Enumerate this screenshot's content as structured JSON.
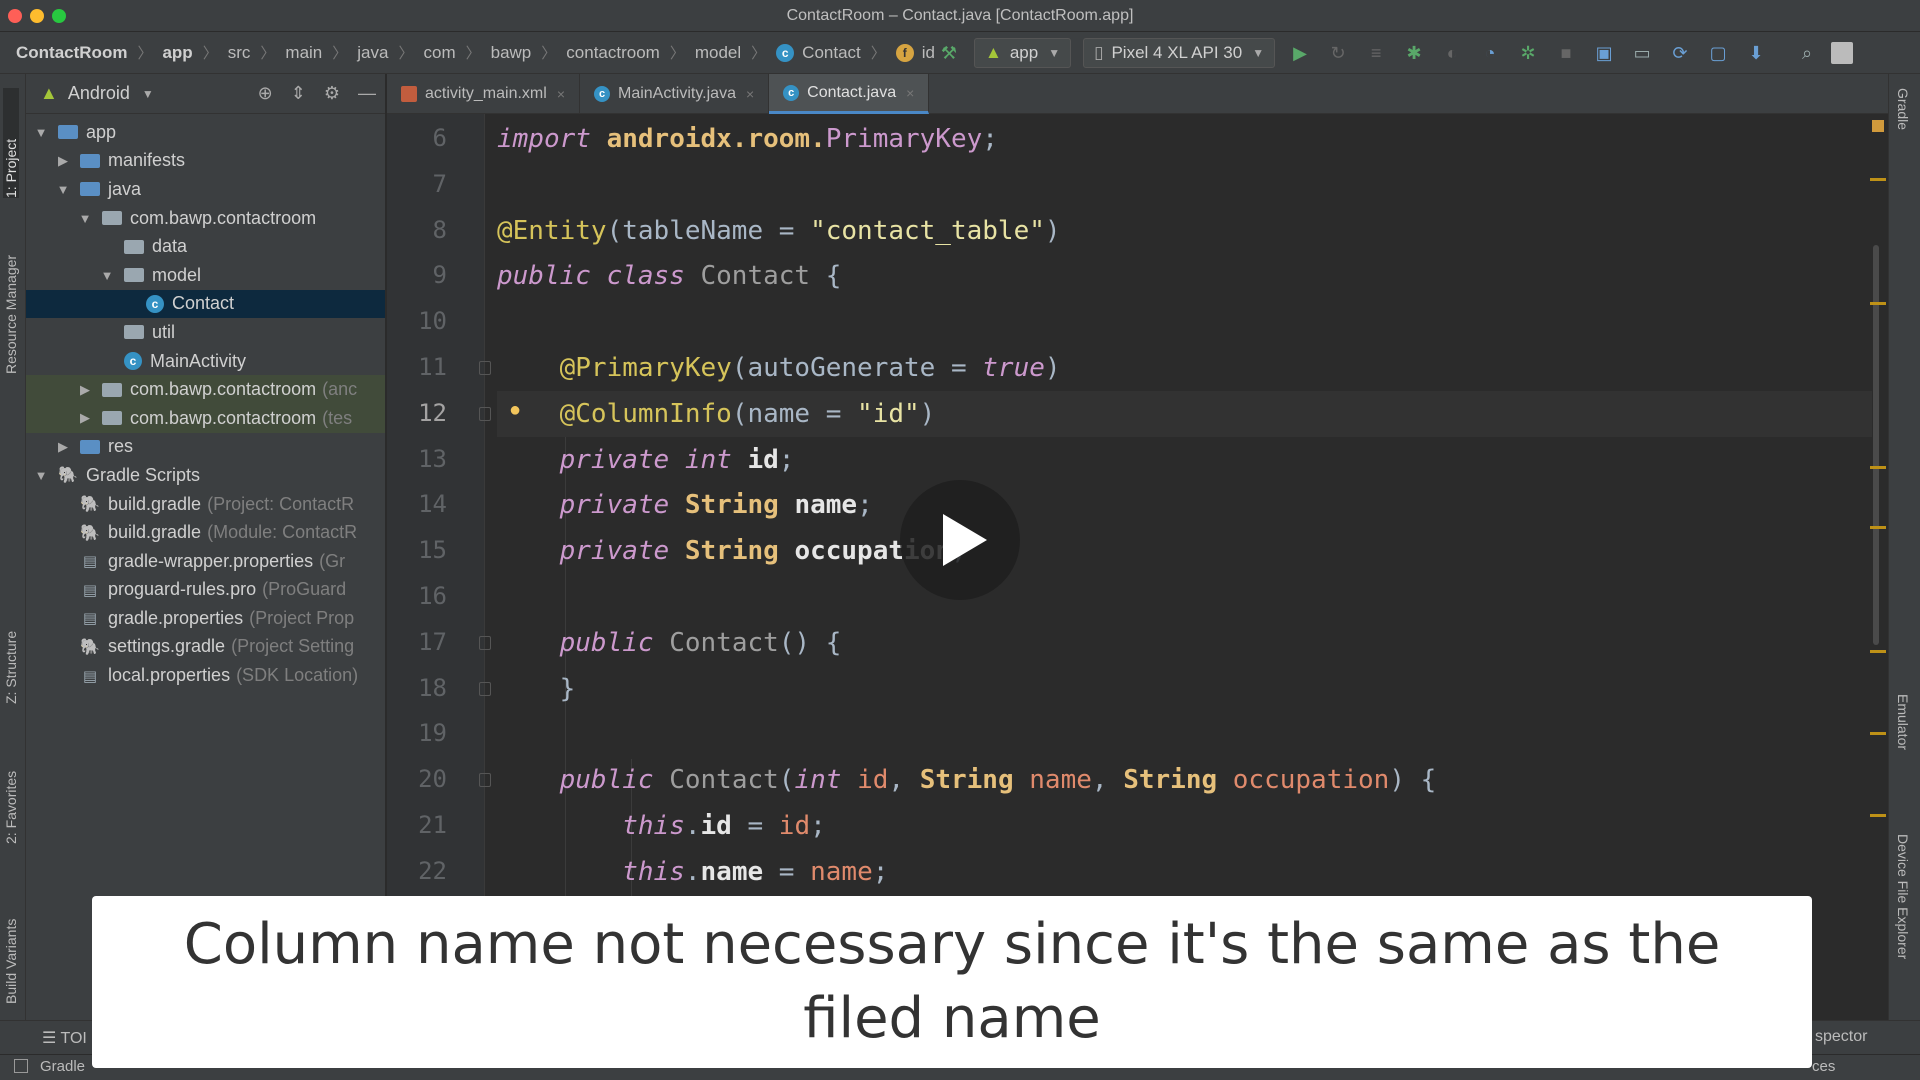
{
  "window": {
    "title": "ContactRoom – Contact.java [ContactRoom.app]"
  },
  "breadcrumb": [
    "ContactRoom",
    "app",
    "src",
    "main",
    "java",
    "com",
    "bawp",
    "contactroom",
    "model",
    "Contact",
    "id"
  ],
  "toolbar": {
    "run_config": "app",
    "device": "Pixel 4 XL API 30"
  },
  "left_tabs": {
    "project": "1: Project",
    "resource_manager": "Resource Manager",
    "structure": "Z: Structure",
    "favorites": "2: Favorites",
    "build_variants": "Build Variants"
  },
  "right_tabs": {
    "gradle": "Gradle",
    "emulator": "Emulator",
    "device_file_explorer": "Device File Explorer"
  },
  "project_panel": {
    "view": "Android",
    "tree": [
      {
        "label": "app",
        "suffix": "",
        "level": 0,
        "arrow": "down",
        "icon": "app"
      },
      {
        "label": "manifests",
        "suffix": "",
        "level": 1,
        "arrow": "right",
        "icon": "folder"
      },
      {
        "label": "java",
        "suffix": "",
        "level": 1,
        "arrow": "down",
        "icon": "folder"
      },
      {
        "label": "com.bawp.contactroom",
        "suffix": "",
        "level": 2,
        "arrow": "down",
        "icon": "pkg"
      },
      {
        "label": "data",
        "suffix": "",
        "level": 3,
        "arrow": "",
        "icon": "pkg"
      },
      {
        "label": "model",
        "suffix": "",
        "level": 3,
        "arrow": "down",
        "icon": "pkg"
      },
      {
        "label": "Contact",
        "suffix": "",
        "level": 4,
        "arrow": "",
        "icon": "class",
        "selected": true
      },
      {
        "label": "util",
        "suffix": "",
        "level": 3,
        "arrow": "",
        "icon": "pkg"
      },
      {
        "label": "MainActivity",
        "suffix": "",
        "level": 3,
        "arrow": "",
        "icon": "class"
      },
      {
        "label": "com.bawp.contactroom",
        "suffix": "(anc",
        "level": 2,
        "arrow": "right",
        "icon": "pkg",
        "hilite": true
      },
      {
        "label": "com.bawp.contactroom",
        "suffix": "(tes",
        "level": 2,
        "arrow": "right",
        "icon": "pkg",
        "hilite": true
      },
      {
        "label": "res",
        "suffix": "",
        "level": 1,
        "arrow": "right",
        "icon": "folder"
      },
      {
        "label": "Gradle Scripts",
        "suffix": "",
        "level": 0,
        "arrow": "down",
        "icon": "gradle"
      },
      {
        "label": "build.gradle",
        "suffix": "(Project: ContactR",
        "level": 1,
        "arrow": "",
        "icon": "gradle"
      },
      {
        "label": "build.gradle",
        "suffix": "(Module: ContactR",
        "level": 1,
        "arrow": "",
        "icon": "gradle"
      },
      {
        "label": "gradle-wrapper.properties",
        "suffix": "(Gr",
        "level": 1,
        "arrow": "",
        "icon": "file"
      },
      {
        "label": "proguard-rules.pro",
        "suffix": "(ProGuard",
        "level": 1,
        "arrow": "",
        "icon": "file"
      },
      {
        "label": "gradle.properties",
        "suffix": "(Project Prop",
        "level": 1,
        "arrow": "",
        "icon": "file"
      },
      {
        "label": "settings.gradle",
        "suffix": "(Project Setting",
        "level": 1,
        "arrow": "",
        "icon": "gradle"
      },
      {
        "label": "local.properties",
        "suffix": "(SDK Location)",
        "level": 1,
        "arrow": "",
        "icon": "file"
      }
    ]
  },
  "editor_tabs": [
    {
      "label": "activity_main.xml",
      "type": "xml",
      "active": false
    },
    {
      "label": "MainActivity.java",
      "type": "java",
      "active": false
    },
    {
      "label": "Contact.java",
      "type": "java",
      "active": true
    }
  ],
  "code": [
    {
      "n": "6",
      "tokens": [
        [
          "kw",
          "import"
        ],
        [
          "pl",
          " "
        ],
        [
          "pkg2",
          "androidx.room."
        ],
        [
          "cls2",
          "PrimaryKey"
        ],
        [
          "pl",
          ";"
        ]
      ]
    },
    {
      "n": "7",
      "tokens": []
    },
    {
      "n": "8",
      "tokens": [
        [
          "an",
          "@Entity"
        ],
        [
          "pl",
          "(tableName = "
        ],
        [
          "str",
          "\"contact_table\""
        ],
        [
          "pl",
          ")"
        ]
      ]
    },
    {
      "n": "9",
      "tokens": [
        [
          "kw",
          "public class"
        ],
        [
          "pl",
          " "
        ],
        [
          "cls",
          "Contact"
        ],
        [
          "pl",
          " {"
        ]
      ]
    },
    {
      "n": "10",
      "tokens": []
    },
    {
      "n": "11",
      "tokens": [
        [
          "pl",
          "    "
        ],
        [
          "an",
          "@PrimaryKey"
        ],
        [
          "pl",
          "(autoGenerate = "
        ],
        [
          "kw",
          "true"
        ],
        [
          "pl",
          ")"
        ]
      ]
    },
    {
      "n": "12",
      "tokens": [
        [
          "pl",
          "    "
        ],
        [
          "an",
          "@ColumnInfo"
        ],
        [
          "pl",
          "(name = "
        ],
        [
          "str",
          "\"id\""
        ],
        [
          "pl",
          ")"
        ]
      ],
      "current": true
    },
    {
      "n": "13",
      "tokens": [
        [
          "pl",
          "    "
        ],
        [
          "kw",
          "private int"
        ],
        [
          "pl",
          " "
        ],
        [
          "fld",
          "id"
        ],
        [
          "pl",
          ";"
        ]
      ]
    },
    {
      "n": "14",
      "tokens": [
        [
          "pl",
          "    "
        ],
        [
          "kw",
          "private"
        ],
        [
          "pl",
          " "
        ],
        [
          "ty",
          "String"
        ],
        [
          "pl",
          " "
        ],
        [
          "fld",
          "name"
        ],
        [
          "pl",
          ";"
        ]
      ]
    },
    {
      "n": "15",
      "tokens": [
        [
          "pl",
          "    "
        ],
        [
          "kw",
          "private"
        ],
        [
          "pl",
          " "
        ],
        [
          "ty",
          "String"
        ],
        [
          "pl",
          " "
        ],
        [
          "fld",
          "occupation"
        ],
        [
          "pl",
          ";"
        ]
      ]
    },
    {
      "n": "16",
      "tokens": []
    },
    {
      "n": "17",
      "tokens": [
        [
          "pl",
          "    "
        ],
        [
          "kw",
          "public"
        ],
        [
          "pl",
          " "
        ],
        [
          "cls",
          "Contact"
        ],
        [
          "pl",
          "() {"
        ]
      ]
    },
    {
      "n": "18",
      "tokens": [
        [
          "pl",
          "    }"
        ]
      ]
    },
    {
      "n": "19",
      "tokens": []
    },
    {
      "n": "20",
      "tokens": [
        [
          "pl",
          "    "
        ],
        [
          "kw",
          "public"
        ],
        [
          "pl",
          " "
        ],
        [
          "cls",
          "Contact"
        ],
        [
          "pl",
          "("
        ],
        [
          "kw",
          "int"
        ],
        [
          "pl",
          " "
        ],
        [
          "par",
          "id"
        ],
        [
          "pl",
          ", "
        ],
        [
          "ty",
          "String"
        ],
        [
          "pl",
          " "
        ],
        [
          "par",
          "name"
        ],
        [
          "pl",
          ", "
        ],
        [
          "ty",
          "String"
        ],
        [
          "pl",
          " "
        ],
        [
          "par",
          "occupation"
        ],
        [
          "pl",
          ") {"
        ]
      ]
    },
    {
      "n": "21",
      "tokens": [
        [
          "pl",
          "        "
        ],
        [
          "kw",
          "this"
        ],
        [
          "pl",
          "."
        ],
        [
          "fld",
          "id"
        ],
        [
          "pl",
          " = "
        ],
        [
          "par",
          "id"
        ],
        [
          "pl",
          ";"
        ]
      ]
    },
    {
      "n": "22",
      "tokens": [
        [
          "pl",
          "        "
        ],
        [
          "kw",
          "this"
        ],
        [
          "pl",
          "."
        ],
        [
          "fld",
          "name"
        ],
        [
          "pl",
          " = "
        ],
        [
          "par",
          "name"
        ],
        [
          "pl",
          ";"
        ]
      ]
    }
  ],
  "bottom_tabs": {
    "todo": "TOI",
    "inspector": "spector"
  },
  "status": {
    "left": "Gradle",
    "right": "ces"
  },
  "caption": "Column name not necessary since it's the same as the filed name"
}
